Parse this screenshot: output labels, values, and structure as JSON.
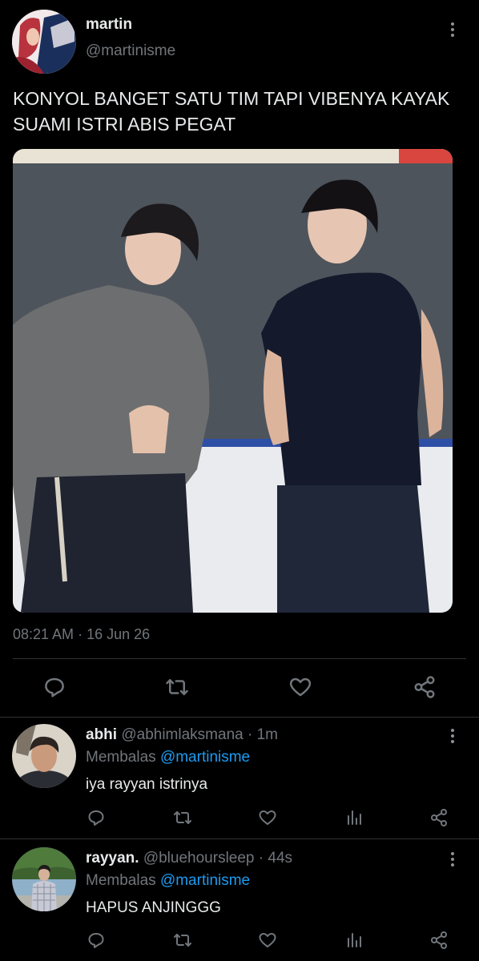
{
  "tweet": {
    "author_name": "martin",
    "author_handle": "@martinisme",
    "text": "KONYOL BANGET SATU TIM TAPI VIBENYA KAYAK SUAMI ISTRI ABIS PEGAT",
    "time": "08:21 AM",
    "separator": "·",
    "date": "16 Jun 26",
    "photo_description": "photo"
  },
  "replies": [
    {
      "name": "abhi",
      "handle": "@abhimlaksmana",
      "meta": "· 1m",
      "replying_prefix": "Membalas",
      "replying_to": "@martinisme",
      "text": "iya rayyan istrinya"
    },
    {
      "name": "rayyan.",
      "handle": "@bluehoursleep",
      "meta": "· 44s",
      "replying_prefix": "Membalas",
      "replying_to": "@martinisme",
      "text": "HAPUS ANJINGGG"
    }
  ],
  "colors": {
    "background": "#000000",
    "text": "#e7e9ea",
    "muted": "#71767b",
    "link": "#1d9bf0",
    "divider": "#2f3336"
  },
  "icons": [
    "more-icon",
    "reply-icon",
    "retweet-icon",
    "like-icon",
    "share-icon",
    "views-icon"
  ]
}
